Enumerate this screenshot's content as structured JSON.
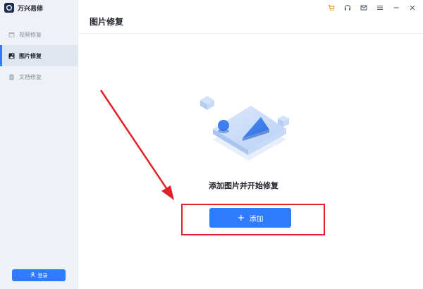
{
  "app": {
    "name": "万兴易修"
  },
  "sidebar": {
    "items": [
      {
        "label": "视频修复",
        "icon": "video-icon",
        "active": false
      },
      {
        "label": "图片修复",
        "icon": "image-icon",
        "active": true
      },
      {
        "label": "文档修复",
        "icon": "document-icon",
        "active": false
      }
    ],
    "login_label": "登录"
  },
  "titlebar": {
    "icons": [
      "cart-icon",
      "headset-icon",
      "mail-icon",
      "menu-icon",
      "minimize-icon",
      "close-icon"
    ]
  },
  "main": {
    "title": "图片修复",
    "prompt": "添加图片并开始修复",
    "add_label": "添加"
  },
  "colors": {
    "accent": "#2f7bff",
    "sidebar_bg": "#eef2f7",
    "annotation_red": "#e0232a",
    "cart_orange": "#f08a24"
  }
}
